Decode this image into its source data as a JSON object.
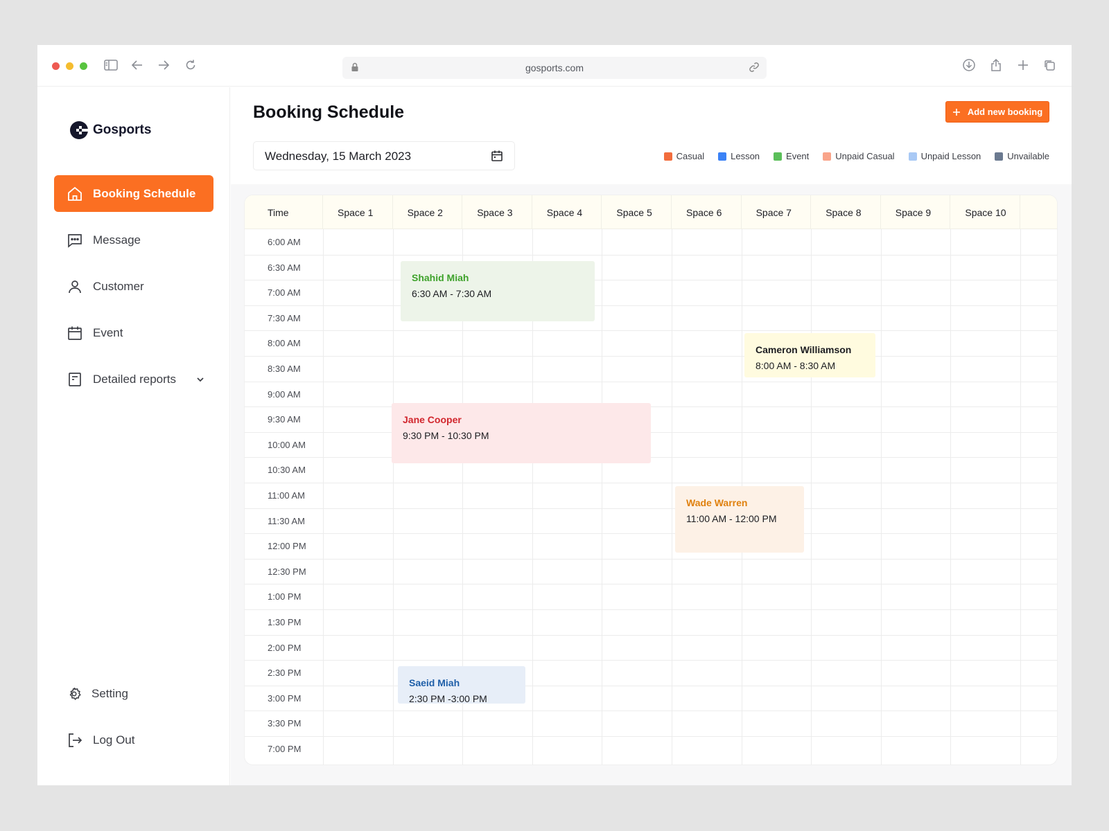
{
  "browser": {
    "url": "gosports.com"
  },
  "sidebar": {
    "brand": "Gosports",
    "items": [
      {
        "label": "Booking Schedule",
        "icon": "home-icon",
        "active": true
      },
      {
        "label": "Message",
        "icon": "message-icon",
        "active": false
      },
      {
        "label": "Customer",
        "icon": "user-icon",
        "active": false
      },
      {
        "label": "Event",
        "icon": "calendar-icon",
        "active": false
      },
      {
        "label": "Detailed reports",
        "icon": "report-icon",
        "active": false
      }
    ],
    "bottom_items": [
      {
        "label": "Setting",
        "icon": "gear-icon"
      },
      {
        "label": "Log Out",
        "icon": "logout-icon"
      }
    ]
  },
  "header": {
    "title": "Booking Schedule",
    "add_button": "Add new booking",
    "date": "Wednesday, 15 March 2023"
  },
  "legend": [
    {
      "label": "Casual",
      "color": "#f26d3d"
    },
    {
      "label": "Lesson",
      "color": "#3b82f6"
    },
    {
      "label": "Event",
      "color": "#5bbf5a"
    },
    {
      "label": "Unpaid Casual",
      "color": "#f9a48a"
    },
    {
      "label": "Unpaid Lesson",
      "color": "#a9c9f5"
    },
    {
      "label": "Unvailable",
      "color": "#6b7a90"
    }
  ],
  "schedule": {
    "time_header": "Time",
    "spaces": [
      "Space 1",
      "Space 2",
      "Space 3",
      "Space 4",
      "Space 5",
      "Space 6",
      "Space 7",
      "Space 8",
      "Space 9",
      "Space 10"
    ],
    "times": [
      "6:00 AM",
      "6:30 AM",
      "7:00 AM",
      "7:30 AM",
      "8:00 AM",
      "8:30 AM",
      "9:00 AM",
      "9:30 AM",
      "10:00 AM",
      "10:30 AM",
      "11:00 AM",
      "11:30 AM",
      "12:00 PM",
      "12:30 PM",
      "1:00 PM",
      "1:30 PM",
      "2:00 PM",
      "2:30 PM",
      "3:00 PM",
      "3:30 PM",
      "7:00 PM"
    ],
    "bookings": [
      {
        "name": "Shahid Miah",
        "time": "6:30 AM - 7:30 AM",
        "bg": "#edf4e9",
        "name_color": "#3ea22b"
      },
      {
        "name": "Cameron Williamson",
        "time": "8:00 AM - 8:30 AM",
        "bg": "#fffbdf",
        "name_color": "#1c1d21"
      },
      {
        "name": "Jane Cooper",
        "time": "9:30 PM - 10:30  PM",
        "bg": "#fde8e9",
        "name_color": "#d1262d"
      },
      {
        "name": "Wade Warren",
        "time": "11:00 AM - 12:00 PM",
        "bg": "#fdf1e6",
        "name_color": "#e0810e"
      },
      {
        "name": "Saeid Miah",
        "time": "2:30 PM -3:00 PM",
        "bg": "#e7eef8",
        "name_color": "#1f5fa8"
      }
    ]
  }
}
